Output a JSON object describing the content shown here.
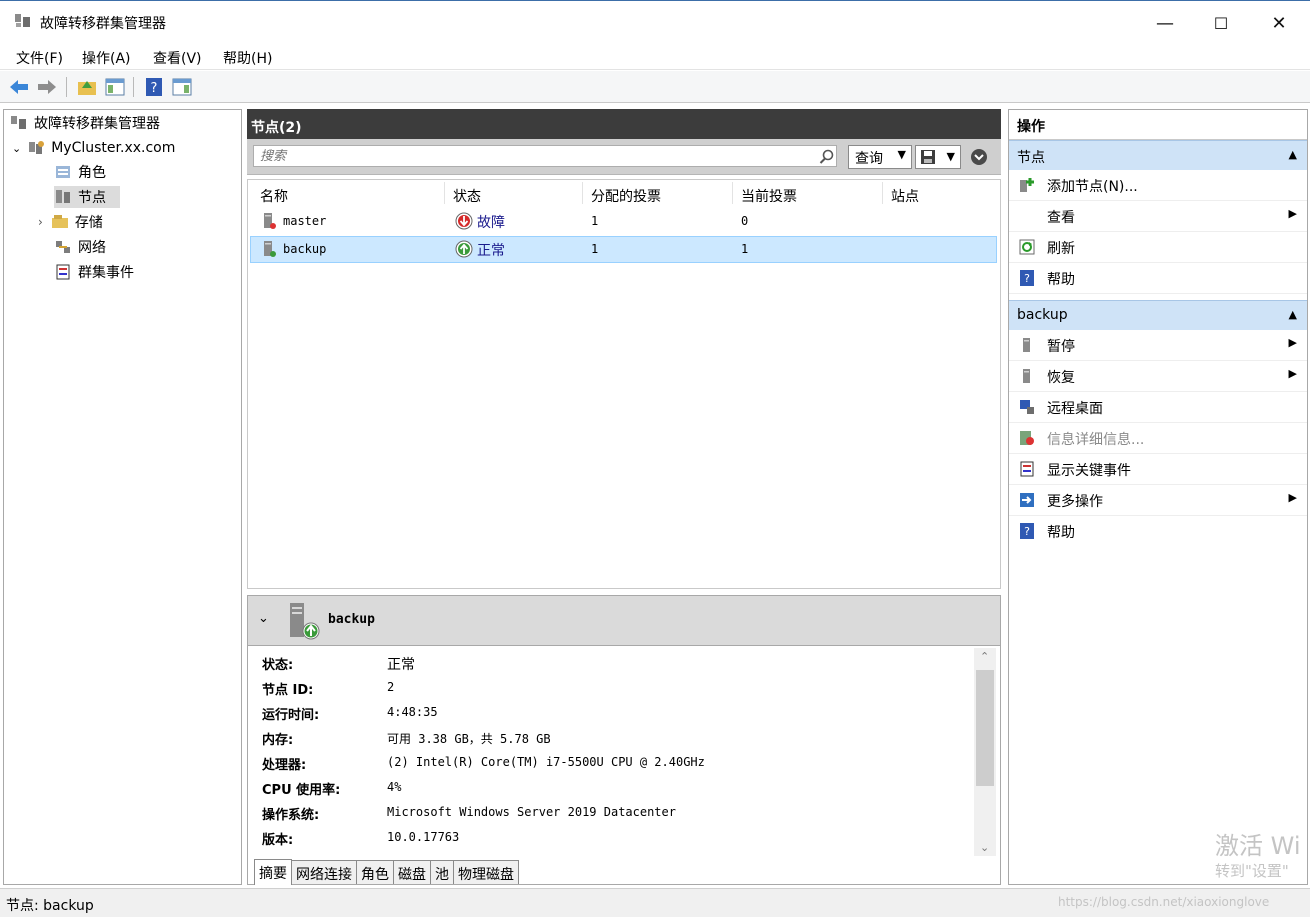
{
  "window": {
    "title": "故障转移群集管理器",
    "min": "—",
    "max": "☐",
    "close": "✕"
  },
  "menu": [
    "文件(F)",
    "操作(A)",
    "查看(V)",
    "帮助(H)"
  ],
  "tree": {
    "root": "故障转移群集管理器",
    "cluster": "MyCluster.xx.com",
    "items": [
      "角色",
      "节点",
      "存储",
      "网络",
      "群集事件"
    ]
  },
  "nodes": {
    "header": "节点(2)",
    "search_placeholder": "搜索",
    "query_label": "查询",
    "columns": [
      "名称",
      "状态",
      "分配的投票",
      "当前投票",
      "站点"
    ],
    "rows": [
      {
        "name": "master",
        "status": "故障",
        "assigned": "1",
        "current": "0"
      },
      {
        "name": "backup",
        "status": "正常",
        "assigned": "1",
        "current": "1"
      }
    ]
  },
  "details": {
    "title": "backup",
    "props": [
      {
        "k": "状态:",
        "v": "正常"
      },
      {
        "k": "节点 ID:",
        "v": "2"
      },
      {
        "k": "运行时间:",
        "v": "4:48:35"
      },
      {
        "k": "内存:",
        "v": "可用 3.38 GB，共 5.78 GB"
      },
      {
        "k": "处理器:",
        "v": "(2) Intel(R) Core(TM) i7-5500U CPU @ 2.40GHz"
      },
      {
        "k": "CPU 使用率:",
        "v": "4%"
      },
      {
        "k": "操作系统:",
        "v": "Microsoft Windows Server 2019 Datacenter"
      },
      {
        "k": "版本:",
        "v": "10.0.17763"
      }
    ],
    "tabs": [
      "摘要",
      "网络连接",
      "角色",
      "磁盘",
      "池",
      "物理磁盘"
    ]
  },
  "actions": {
    "header": "操作",
    "section1": "节点",
    "section1_items": [
      "添加节点(N)...",
      "查看",
      "刷新",
      "帮助"
    ],
    "section2": "backup",
    "section2_items": [
      "暂停",
      "恢复",
      "远程桌面",
      "信息详细信息...",
      "显示关键事件",
      "更多操作",
      "帮助"
    ]
  },
  "status": "节点: backup",
  "watermark": {
    "line1": "激活 Wi",
    "line2": "转到\"设置\"",
    "url": "https://blog.csdn.net/xiaoxionglove"
  }
}
